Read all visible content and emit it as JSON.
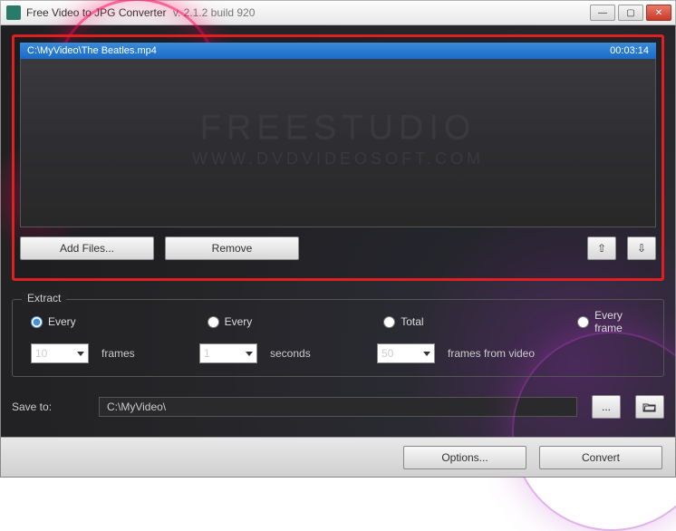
{
  "titlebar": {
    "app_name": "Free Video to JPG Converter",
    "version": "v. 2.1.2 build 920"
  },
  "file_list": {
    "path": "C:\\MyVideo\\The Beatles.mp4",
    "duration": "00:03:14"
  },
  "watermark": {
    "line1": "FREESTUDIO",
    "line2": "WWW.DVDVIDEOSOFT.COM"
  },
  "buttons": {
    "add_files": "Add Files...",
    "remove": "Remove",
    "options": "Options...",
    "convert": "Convert",
    "browse": "...",
    "move_up": "⇧",
    "move_down": "⇩",
    "open_folder": "↪"
  },
  "extract": {
    "legend": "Extract",
    "opt1": "Every",
    "opt2": "Every",
    "opt3": "Total",
    "opt4": "Every frame",
    "val1": "10",
    "unit1": "frames",
    "val2": "1",
    "unit2": "seconds",
    "val3": "50",
    "unit3": "frames from video"
  },
  "save": {
    "label": "Save to:",
    "path": "C:\\MyVideo\\"
  }
}
